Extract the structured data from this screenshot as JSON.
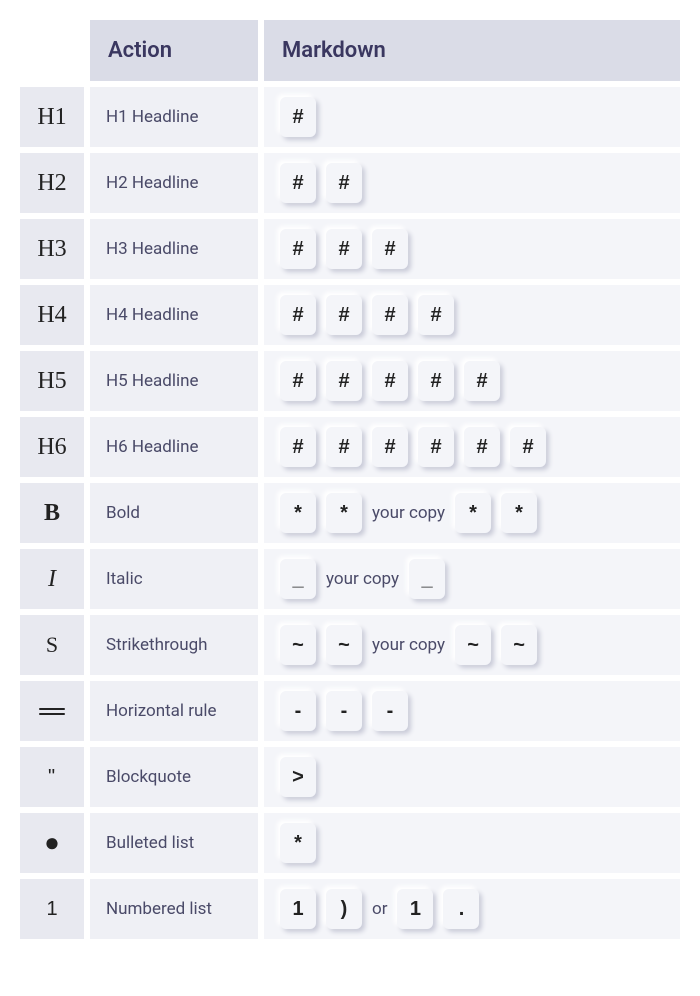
{
  "headers": {
    "action": "Action",
    "markdown": "Markdown"
  },
  "copy_placeholder": "your copy",
  "or_label": "or",
  "rows": [
    {
      "symbol": "H1",
      "symbol_type": "serif-big",
      "action": "H1 Headline",
      "md": [
        {
          "t": "k",
          "v": "#"
        }
      ]
    },
    {
      "symbol": "H2",
      "symbol_type": "serif-big",
      "action": "H2 Headline",
      "md": [
        {
          "t": "k",
          "v": "#"
        },
        {
          "t": "k",
          "v": "#"
        }
      ]
    },
    {
      "symbol": "H3",
      "symbol_type": "serif-big",
      "action": "H3 Headline",
      "md": [
        {
          "t": "k",
          "v": "#"
        },
        {
          "t": "k",
          "v": "#"
        },
        {
          "t": "k",
          "v": "#"
        }
      ]
    },
    {
      "symbol": "H4",
      "symbol_type": "serif-big",
      "action": "H4 Headline",
      "md": [
        {
          "t": "k",
          "v": "#"
        },
        {
          "t": "k",
          "v": "#"
        },
        {
          "t": "k",
          "v": "#"
        },
        {
          "t": "k",
          "v": "#"
        }
      ]
    },
    {
      "symbol": "H5",
      "symbol_type": "serif-big",
      "action": "H5 Headline",
      "md": [
        {
          "t": "k",
          "v": "#"
        },
        {
          "t": "k",
          "v": "#"
        },
        {
          "t": "k",
          "v": "#"
        },
        {
          "t": "k",
          "v": "#"
        },
        {
          "t": "k",
          "v": "#"
        }
      ]
    },
    {
      "symbol": "H6",
      "symbol_type": "serif-big",
      "action": "H6 Headline",
      "md": [
        {
          "t": "k",
          "v": "#"
        },
        {
          "t": "k",
          "v": "#"
        },
        {
          "t": "k",
          "v": "#"
        },
        {
          "t": "k",
          "v": "#"
        },
        {
          "t": "k",
          "v": "#"
        },
        {
          "t": "k",
          "v": "#"
        }
      ]
    },
    {
      "symbol": "B",
      "symbol_type": "bold",
      "action": "Bold",
      "md": [
        {
          "t": "k",
          "v": "*"
        },
        {
          "t": "k",
          "v": "*"
        },
        {
          "t": "copy"
        },
        {
          "t": "k",
          "v": "*"
        },
        {
          "t": "k",
          "v": "*"
        }
      ]
    },
    {
      "symbol": "I",
      "symbol_type": "italic",
      "action": "Italic",
      "md": [
        {
          "t": "k",
          "v": "_"
        },
        {
          "t": "copy"
        },
        {
          "t": "k",
          "v": "_"
        }
      ]
    },
    {
      "symbol": "S",
      "symbol_type": "plain",
      "action": "Strikethrough",
      "md": [
        {
          "t": "k",
          "v": "~"
        },
        {
          "t": "k",
          "v": "~"
        },
        {
          "t": "copy"
        },
        {
          "t": "k",
          "v": "~"
        },
        {
          "t": "k",
          "v": "~"
        }
      ]
    },
    {
      "symbol": "hr",
      "symbol_type": "hr",
      "action": "Horizontal rule",
      "md": [
        {
          "t": "k",
          "v": "-"
        },
        {
          "t": "k",
          "v": "-"
        },
        {
          "t": "k",
          "v": "-"
        }
      ]
    },
    {
      "symbol": "\"",
      "symbol_type": "quote",
      "action": "Blockquote",
      "md": [
        {
          "t": "k",
          "v": ">"
        }
      ]
    },
    {
      "symbol": "●",
      "symbol_type": "dot",
      "action": "Bulleted list",
      "md": [
        {
          "t": "k",
          "v": "*"
        }
      ]
    },
    {
      "symbol": "1",
      "symbol_type": "num",
      "action": "Numbered list",
      "md": [
        {
          "t": "k",
          "v": "1"
        },
        {
          "t": "k",
          "v": ")"
        },
        {
          "t": "or"
        },
        {
          "t": "k",
          "v": "1"
        },
        {
          "t": "k",
          "v": "."
        }
      ]
    }
  ]
}
